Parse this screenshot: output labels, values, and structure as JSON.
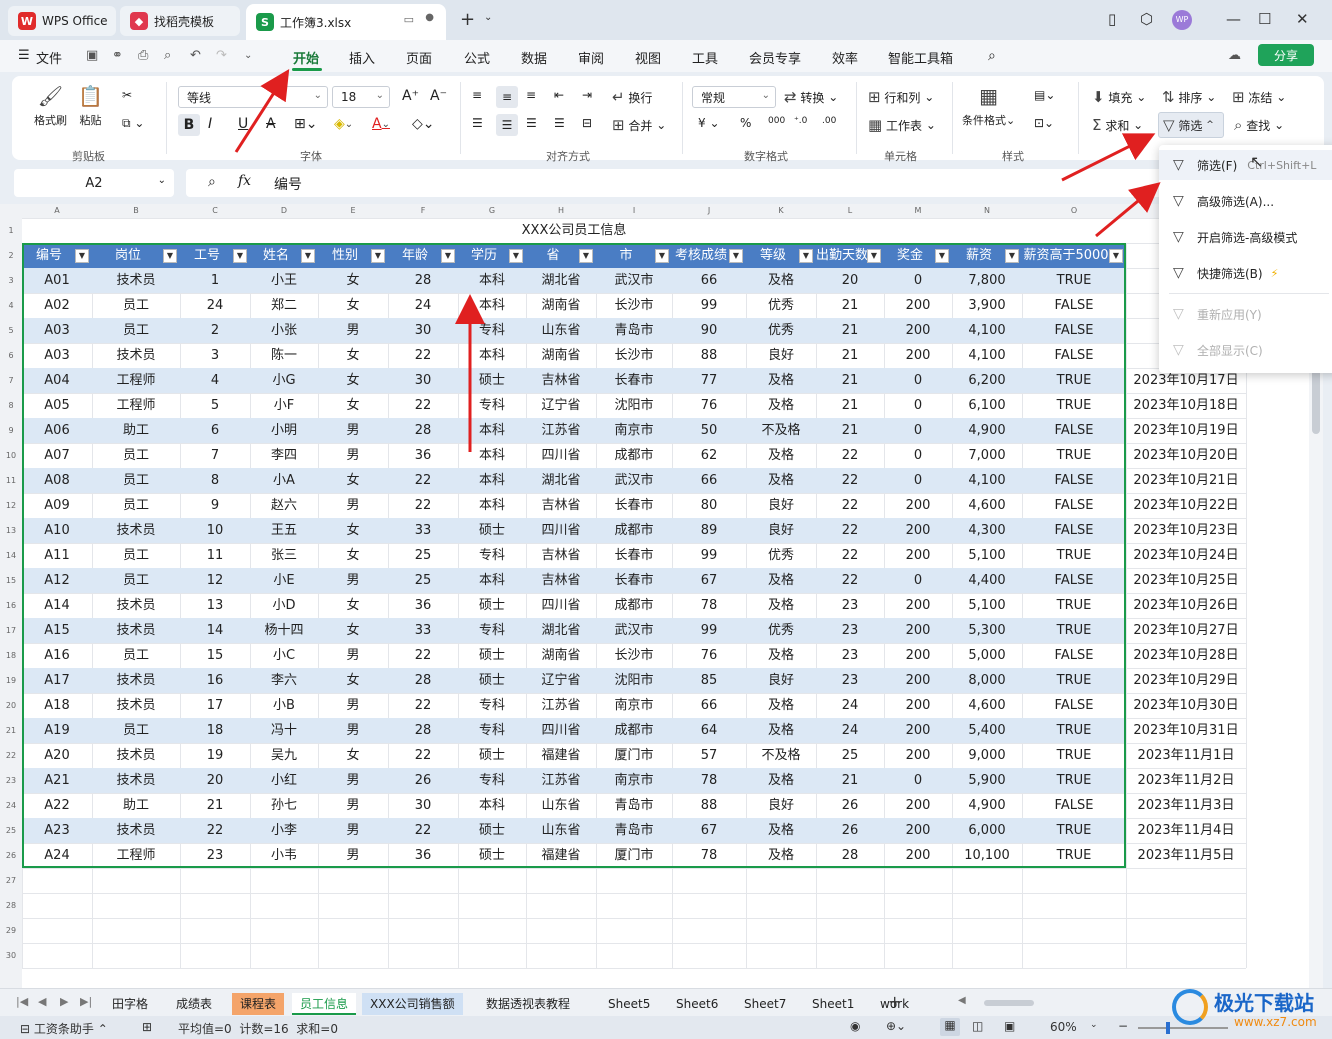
{
  "titlebar": {
    "tabs": [
      {
        "label": "WPS Office",
        "icon": "wps-logo-icon",
        "color": "#e02b2b"
      },
      {
        "label": "找稻壳模板",
        "icon": "daoke-icon",
        "color": "#e0384e"
      },
      {
        "label": "工作簿3.xlsx",
        "icon": "spreadsheet-icon",
        "color": "#1a9a4a"
      }
    ],
    "avatar": "WP"
  },
  "menubar": {
    "file": "文件",
    "items": [
      "开始",
      "插入",
      "页面",
      "公式",
      "数据",
      "审阅",
      "视图",
      "工具",
      "会员专享",
      "效率",
      "智能工具箱"
    ],
    "share": "分享"
  },
  "ribbon": {
    "clipboard": {
      "format_painter": "格式刷",
      "paste": "粘贴",
      "group": "剪贴板"
    },
    "font": {
      "name": "等线",
      "size": "18",
      "group": "字体"
    },
    "align": {
      "wrap": "换行",
      "merge": "合并",
      "group": "对齐方式"
    },
    "number": {
      "format": "常规",
      "convert": "转换",
      "group": "数字格式"
    },
    "cells": {
      "rowcol": "行和列",
      "worksheet": "工作表",
      "group": "单元格"
    },
    "styles": {
      "cond_format": "条件格式",
      "group": "样式"
    },
    "edit": {
      "fill": "填充",
      "sort": "排序",
      "freeze": "冻结",
      "sum": "求和",
      "filter": "筛选",
      "find": "查找"
    }
  },
  "formula": {
    "cell_ref": "A2",
    "fx": "fx",
    "content": "编号"
  },
  "sheet": {
    "columns": [
      "A",
      "B",
      "C",
      "D",
      "E",
      "F",
      "G",
      "H",
      "I",
      "J",
      "K",
      "L",
      "M",
      "N",
      "O"
    ],
    "title": "XXX公司员工信息",
    "headers": [
      "编号",
      "岗位",
      "工号",
      "姓名",
      "性别",
      "年龄",
      "学历",
      "省",
      "市",
      "考核成绩",
      "等级",
      "出勤天数",
      "奖金",
      "薪资",
      "薪资高于5000"
    ],
    "rows": [
      [
        "A01",
        "技术员",
        "1",
        "小王",
        "女",
        "28",
        "本科",
        "湖北省",
        "武汉市",
        "66",
        "及格",
        "20",
        "0",
        "7,800",
        "TRUE",
        ""
      ],
      [
        "A02",
        "员工",
        "24",
        "郑二",
        "女",
        "24",
        "本科",
        "湖南省",
        "长沙市",
        "99",
        "优秀",
        "21",
        "200",
        "3,900",
        "FALSE",
        ""
      ],
      [
        "A03",
        "员工",
        "2",
        "小张",
        "男",
        "30",
        "专科",
        "山东省",
        "青岛市",
        "90",
        "优秀",
        "21",
        "200",
        "4,100",
        "FALSE",
        ""
      ],
      [
        "A03",
        "技术员",
        "3",
        "陈一",
        "女",
        "22",
        "本科",
        "湖南省",
        "长沙市",
        "88",
        "良好",
        "21",
        "200",
        "4,100",
        "FALSE",
        ""
      ],
      [
        "A04",
        "工程师",
        "4",
        "小G",
        "女",
        "30",
        "硕士",
        "吉林省",
        "长春市",
        "77",
        "及格",
        "21",
        "0",
        "6,200",
        "TRUE",
        "2023年10月17日"
      ],
      [
        "A05",
        "工程师",
        "5",
        "小F",
        "女",
        "22",
        "专科",
        "辽宁省",
        "沈阳市",
        "76",
        "及格",
        "21",
        "0",
        "6,100",
        "TRUE",
        "2023年10月18日"
      ],
      [
        "A06",
        "助工",
        "6",
        "小明",
        "男",
        "28",
        "本科",
        "江苏省",
        "南京市",
        "50",
        "不及格",
        "21",
        "0",
        "4,900",
        "FALSE",
        "2023年10月19日"
      ],
      [
        "A07",
        "员工",
        "7",
        "李四",
        "男",
        "36",
        "本科",
        "四川省",
        "成都市",
        "62",
        "及格",
        "22",
        "0",
        "7,000",
        "TRUE",
        "2023年10月20日"
      ],
      [
        "A08",
        "员工",
        "8",
        "小A",
        "女",
        "22",
        "本科",
        "湖北省",
        "武汉市",
        "66",
        "及格",
        "22",
        "0",
        "4,100",
        "FALSE",
        "2023年10月21日"
      ],
      [
        "A09",
        "员工",
        "9",
        "赵六",
        "男",
        "22",
        "本科",
        "吉林省",
        "长春市",
        "80",
        "良好",
        "22",
        "200",
        "4,600",
        "FALSE",
        "2023年10月22日"
      ],
      [
        "A10",
        "技术员",
        "10",
        "王五",
        "女",
        "33",
        "硕士",
        "四川省",
        "成都市",
        "89",
        "良好",
        "22",
        "200",
        "4,300",
        "FALSE",
        "2023年10月23日"
      ],
      [
        "A11",
        "员工",
        "11",
        "张三",
        "女",
        "25",
        "专科",
        "吉林省",
        "长春市",
        "99",
        "优秀",
        "22",
        "200",
        "5,100",
        "TRUE",
        "2023年10月24日"
      ],
      [
        "A12",
        "员工",
        "12",
        "小E",
        "男",
        "25",
        "本科",
        "吉林省",
        "长春市",
        "67",
        "及格",
        "22",
        "0",
        "4,400",
        "FALSE",
        "2023年10月25日"
      ],
      [
        "A14",
        "技术员",
        "13",
        "小D",
        "女",
        "36",
        "硕士",
        "四川省",
        "成都市",
        "78",
        "及格",
        "23",
        "200",
        "5,100",
        "TRUE",
        "2023年10月26日"
      ],
      [
        "A15",
        "技术员",
        "14",
        "杨十四",
        "女",
        "33",
        "专科",
        "湖北省",
        "武汉市",
        "99",
        "优秀",
        "23",
        "200",
        "5,300",
        "TRUE",
        "2023年10月27日"
      ],
      [
        "A16",
        "员工",
        "15",
        "小C",
        "男",
        "22",
        "硕士",
        "湖南省",
        "长沙市",
        "76",
        "及格",
        "23",
        "200",
        "5,000",
        "FALSE",
        "2023年10月28日"
      ],
      [
        "A17",
        "技术员",
        "16",
        "李六",
        "女",
        "28",
        "硕士",
        "辽宁省",
        "沈阳市",
        "85",
        "良好",
        "23",
        "200",
        "8,000",
        "TRUE",
        "2023年10月29日"
      ],
      [
        "A18",
        "技术员",
        "17",
        "小B",
        "男",
        "22",
        "专科",
        "江苏省",
        "南京市",
        "66",
        "及格",
        "24",
        "200",
        "4,600",
        "FALSE",
        "2023年10月30日"
      ],
      [
        "A19",
        "员工",
        "18",
        "冯十",
        "男",
        "28",
        "专科",
        "四川省",
        "成都市",
        "64",
        "及格",
        "24",
        "200",
        "5,400",
        "TRUE",
        "2023年10月31日"
      ],
      [
        "A20",
        "技术员",
        "19",
        "吴九",
        "女",
        "22",
        "硕士",
        "福建省",
        "厦门市",
        "57",
        "不及格",
        "25",
        "200",
        "9,000",
        "TRUE",
        "2023年11月1日"
      ],
      [
        "A21",
        "技术员",
        "20",
        "小红",
        "男",
        "26",
        "专科",
        "江苏省",
        "南京市",
        "78",
        "及格",
        "21",
        "0",
        "5,900",
        "TRUE",
        "2023年11月2日"
      ],
      [
        "A22",
        "助工",
        "21",
        "孙七",
        "男",
        "30",
        "本科",
        "山东省",
        "青岛市",
        "88",
        "良好",
        "26",
        "200",
        "4,900",
        "FALSE",
        "2023年11月3日"
      ],
      [
        "A23",
        "技术员",
        "22",
        "小李",
        "男",
        "22",
        "硕士",
        "山东省",
        "青岛市",
        "67",
        "及格",
        "26",
        "200",
        "6,000",
        "TRUE",
        "2023年11月4日"
      ],
      [
        "A24",
        "工程师",
        "23",
        "小韦",
        "男",
        "36",
        "硕士",
        "福建省",
        "厦门市",
        "78",
        "及格",
        "28",
        "200",
        "10,100",
        "TRUE",
        "2023年11月5日"
      ]
    ]
  },
  "filter_menu": {
    "items": [
      {
        "label": "筛选(F)",
        "shortcut": "Ctrl+Shift+L",
        "enabled": true
      },
      {
        "label": "高级筛选(A)...",
        "enabled": true
      },
      {
        "label": "开启筛选-高级模式",
        "enabled": true
      },
      {
        "label": "快捷筛选(B)",
        "enabled": true
      },
      {
        "label": "重新应用(Y)",
        "enabled": false
      },
      {
        "label": "全部显示(C)",
        "enabled": false
      }
    ]
  },
  "sheet_tabs": [
    "田字格",
    "成绩表",
    "课程表",
    "员工信息",
    "XXX公司销售额",
    "数据透视表教程",
    "Sheet5",
    "Sheet6",
    "Sheet7",
    "Sheet1",
    "work"
  ],
  "statusbar": {
    "assistant": "工资条助手",
    "stats": "平均值=0  计数=16  求和=0",
    "zoom": "60%"
  },
  "watermark": "极光下载站",
  "watermark_url": "www.xz7.com",
  "colors": {
    "accent": "#1a9a4a",
    "header_blue": "#4a7dc4",
    "band": "#dce8f5",
    "arrow": "#e02020"
  }
}
